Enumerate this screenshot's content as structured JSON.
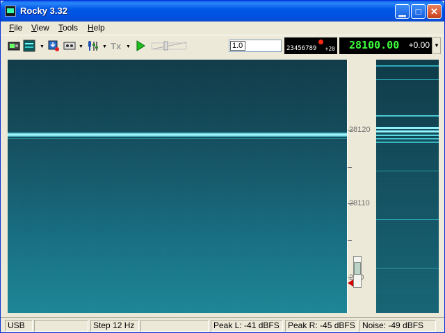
{
  "window": {
    "title": "Rocky 3.32"
  },
  "menu": {
    "items": [
      {
        "label": "File",
        "accel": "F",
        "rest": "ile"
      },
      {
        "label": "View",
        "accel": "V",
        "rest": "iew"
      },
      {
        "label": "Tools",
        "accel": "T",
        "rest": "ools"
      },
      {
        "label": "Help",
        "accel": "H",
        "rest": "elp"
      }
    ]
  },
  "toolbar": {
    "icons": [
      "sound-card-icon",
      "waterfall-icon",
      "record-icon",
      "cassette-icon",
      "microphone-mixer-icon",
      "transmit-icon",
      "play-icon",
      "volume-slider-icon"
    ],
    "step_value": "1.0",
    "lcd_small_digits": "23456789",
    "lcd_small_offset": "+20",
    "frequency": "28100.00",
    "rit_offset": "+0.00"
  },
  "scale": {
    "labels": [
      "28120",
      "28110",
      "28100"
    ],
    "label_display": [
      "28120",
      "28110",
      "2  00"
    ]
  },
  "status": {
    "mode": "USB",
    "blank1": "",
    "step": "Step 12 Hz",
    "blank2": "",
    "peak_l": "Peak L: -41 dBFS",
    "peak_r": "Peak R: -45 dBFS",
    "noise": "Noise: -49 dBFS"
  },
  "colors": {
    "titlebar": "#0058e6",
    "frequency_text": "#3cff3c",
    "waterfall_signal": "#b8fcff",
    "rx_indicator": "#ff2a14"
  }
}
